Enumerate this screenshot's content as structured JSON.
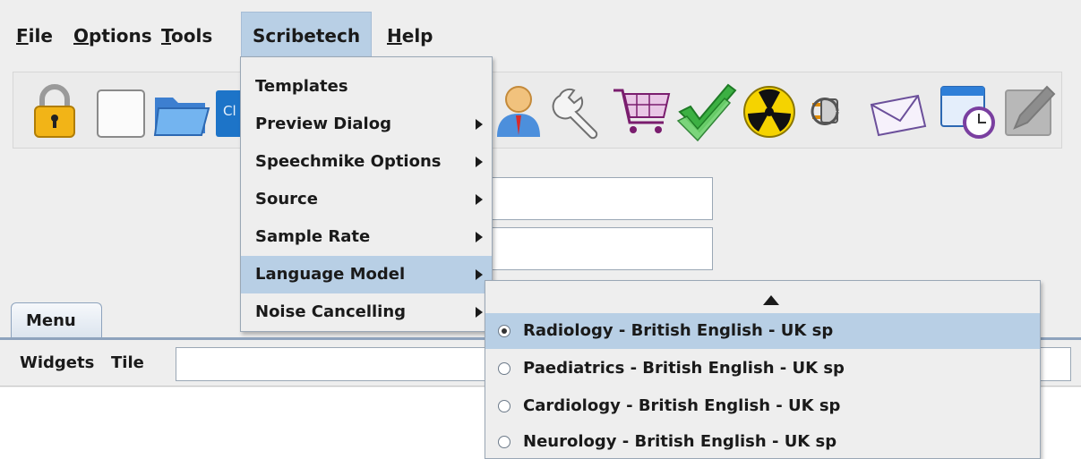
{
  "menubar": {
    "items": [
      {
        "mnemonic": "F",
        "rest": "ile"
      },
      {
        "mnemonic": "O",
        "rest": "ptions"
      },
      {
        "mnemonic": "T",
        "rest": "ools"
      },
      {
        "label": "Scribetech"
      },
      {
        "mnemonic": "H",
        "rest": "elp"
      }
    ]
  },
  "toolbar": {
    "icons": [
      "lock-icon",
      "blank-page-icon",
      "folder-open-icon",
      "blue-button-icon",
      "user-icon",
      "wrench-icon",
      "shopping-cart-icon",
      "double-check-icon",
      "radiation-icon",
      "plug-icon",
      "envelope-icon",
      "window-clock-icon",
      "edit-disabled-icon"
    ],
    "partial_button_text": "Cl"
  },
  "scribetech_menu": {
    "items": [
      {
        "label": "Templates",
        "submenu": false,
        "highlighted": false
      },
      {
        "label": "Preview Dialog",
        "submenu": true,
        "highlighted": false
      },
      {
        "label": "Speechmike Options",
        "submenu": true,
        "highlighted": false
      },
      {
        "label": "Source",
        "submenu": true,
        "highlighted": false
      },
      {
        "label": "Sample Rate",
        "submenu": true,
        "highlighted": false
      },
      {
        "label": "Language Model",
        "submenu": true,
        "highlighted": true
      },
      {
        "label": "Noise Cancelling",
        "submenu": true,
        "highlighted": false
      }
    ]
  },
  "language_model_submenu": {
    "items": [
      {
        "label": "Radiology - British English - UK sp",
        "selected": true,
        "highlighted": true
      },
      {
        "label": "Paediatrics - British English - UK sp",
        "selected": false,
        "highlighted": false
      },
      {
        "label": "Cardiology - British English - UK sp",
        "selected": false,
        "highlighted": false
      },
      {
        "label": "Neurology - British English - UK sp",
        "selected": false,
        "highlighted": false
      }
    ]
  },
  "tabs": {
    "menu_label": "Menu"
  },
  "inner_toolbar": {
    "widgets_label": "Widgets",
    "tile_label": "Tile"
  },
  "colors": {
    "highlight": "#b8cfe5",
    "background": "#eeeeee"
  }
}
